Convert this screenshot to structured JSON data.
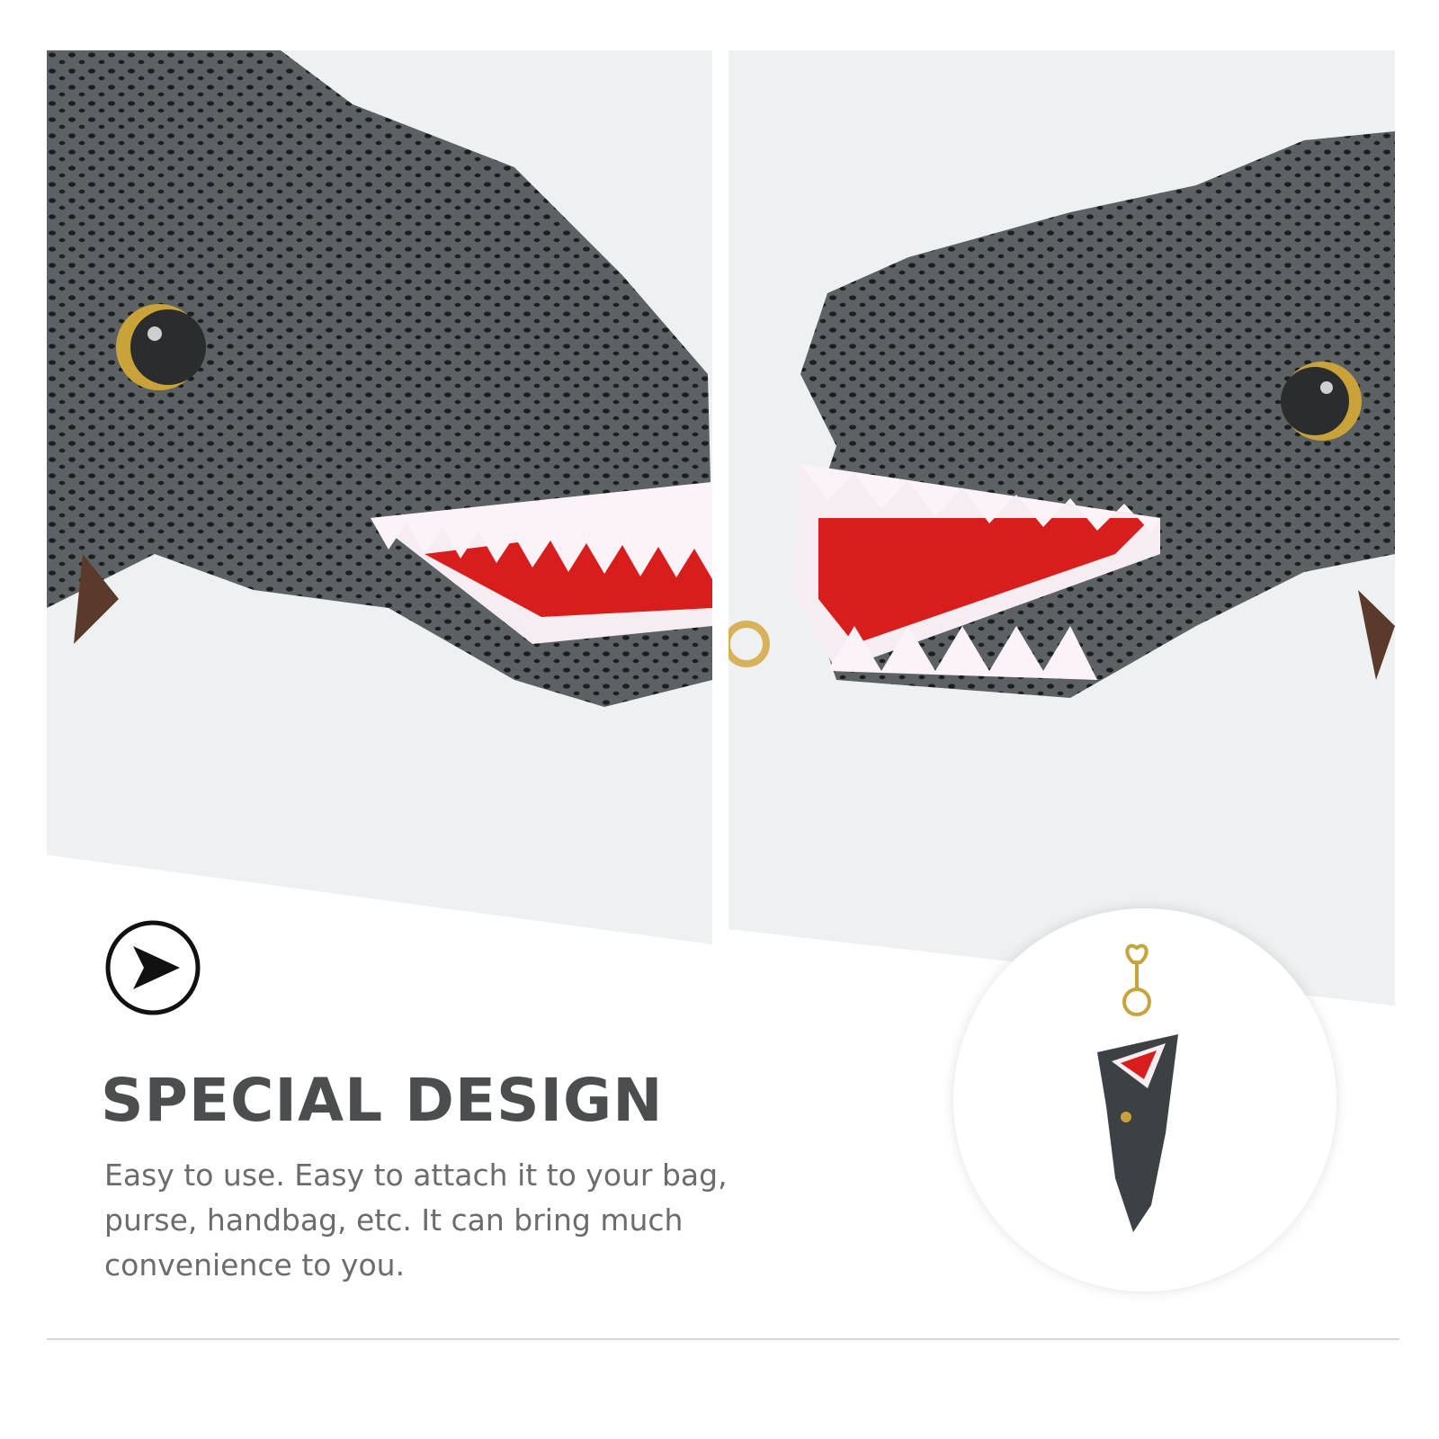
{
  "hero": {
    "left_image": "plush crocodile head facing right with open red mouth",
    "right_image": "plush crocodile head facing left with open red mouth and gold clasp"
  },
  "feature": {
    "icon": "play-arrow-icon",
    "title": "SPECIAL DESIGN",
    "description": "Easy to use. Easy to attach it to your bag, purse, handbag, etc. It can bring much convenience to you."
  },
  "product_thumbnail": {
    "image": "crocodile keychain with gold ring"
  },
  "colors": {
    "heading": "#4b4d4e",
    "body_text": "#6a6c6d",
    "plush_body": "#5a5f61",
    "mouth": "#d81d1d",
    "teeth": "#fbf3f7",
    "divider": "#d4d6d8"
  }
}
